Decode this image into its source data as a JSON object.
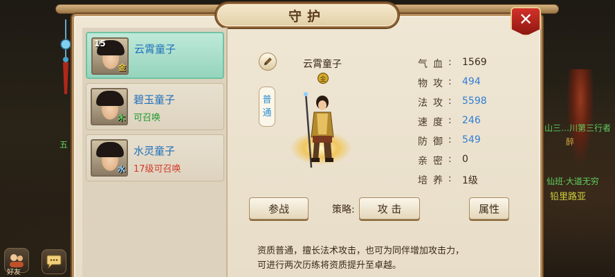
{
  "window": {
    "title": "守护"
  },
  "colors": {
    "blue_value": "#2f7ed6",
    "green_status": "#1f9a2e",
    "red_status": "#d23a2a",
    "close_red": "#c92d22"
  },
  "guardians": [
    {
      "name": "云霄童子",
      "level": "15",
      "element": "金",
      "element_color": "#f3d048",
      "status": "",
      "status_color": "",
      "selected": true
    },
    {
      "name": "碧玉童子",
      "level": "",
      "element": "木",
      "element_color": "#5fd05f",
      "status": "可召唤",
      "status_color": "#1f9a2e",
      "selected": false
    },
    {
      "name": "水灵童子",
      "level": "",
      "element": "水",
      "element_color": "#8fd0ff",
      "status": "17级可召唤",
      "status_color": "#d23a2a",
      "selected": false
    }
  ],
  "detail": {
    "name": "云霄童子",
    "element_badge": "金",
    "tag": [
      "普",
      "通"
    ],
    "stats": [
      {
        "label": "气血",
        "value": "1569",
        "color": "#3a2a18"
      },
      {
        "label": "物攻",
        "value": "494",
        "color": "#2f7ed6"
      },
      {
        "label": "法攻",
        "value": "5598",
        "color": "#2f7ed6"
      },
      {
        "label": "速度",
        "value": "246",
        "color": "#2f7ed6"
      },
      {
        "label": "防御",
        "value": "549",
        "color": "#2f7ed6"
      },
      {
        "label": "亲密",
        "value": "0",
        "color": "#3a2a18"
      },
      {
        "label": "培养",
        "value": "1级",
        "color": "#3a2a18"
      }
    ]
  },
  "buttons": {
    "fight": "参战",
    "strategy_label": "策略:",
    "strategy_value": "攻 击",
    "attributes": "属性"
  },
  "description": [
    "资质普通，擅长法术攻击，也可为同伴增加攻击力，",
    "可进行两次历练将资质提升至卓越。"
  ],
  "background": {
    "npc_labels": [
      "山三…川第三行者",
      "醉",
      "仙班·大道无穷",
      "铅里路亚"
    ],
    "left_label": "五",
    "friends_label": "好友"
  },
  "icons": {
    "close": "close-icon",
    "edit": "pencil-icon",
    "chat": "chat-bubble-icon",
    "friends": "friends-icon"
  }
}
